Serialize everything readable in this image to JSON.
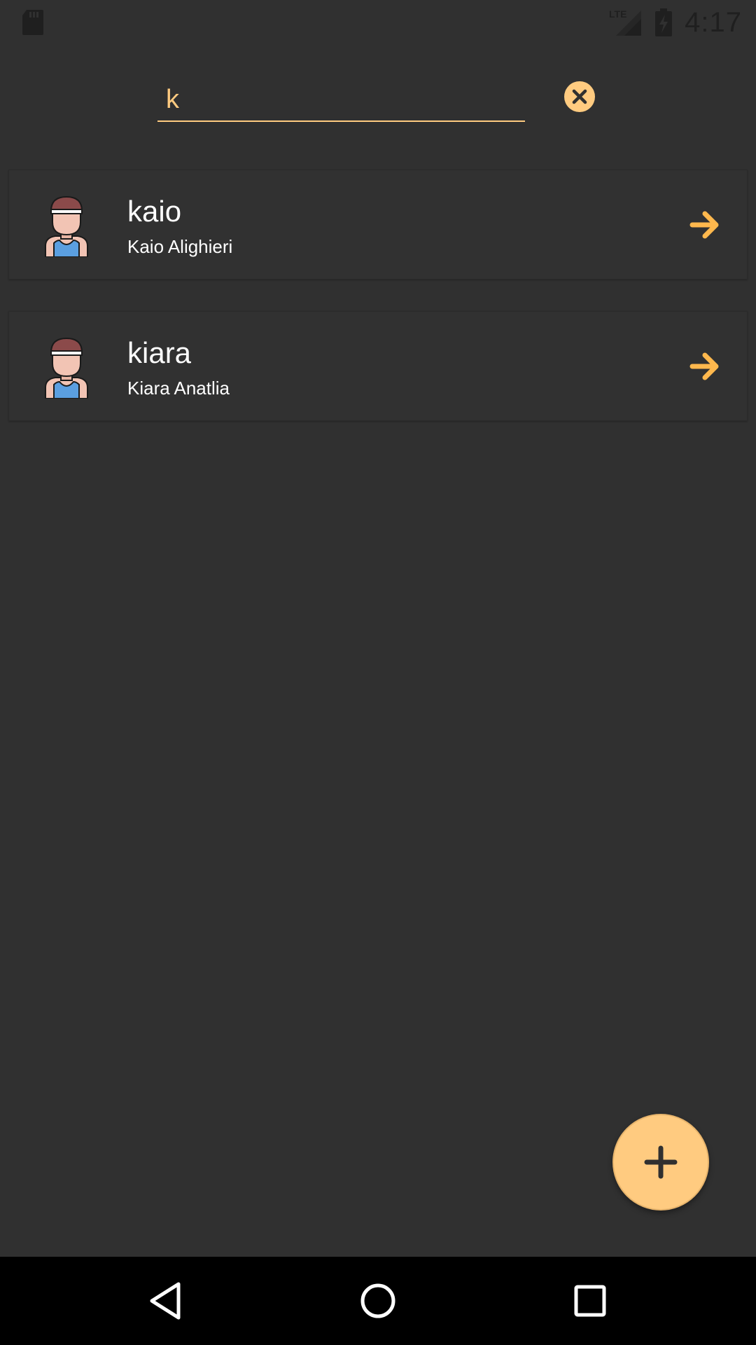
{
  "status_bar": {
    "time": "4:17",
    "network_label": "LTE"
  },
  "search": {
    "value": "k",
    "placeholder": ""
  },
  "users": [
    {
      "username": "kaio",
      "full_name": "Kaio Alighieri"
    },
    {
      "username": "kiara",
      "full_name": "Kiara Anatlia"
    }
  ],
  "icons": {
    "clear": "close-circle-icon",
    "row_action": "arrow-right-icon",
    "fab": "plus-icon",
    "avatar": "user-avatar-icon",
    "nav_back": "back-triangle-icon",
    "nav_home": "home-circle-icon",
    "nav_recents": "recents-square-icon"
  },
  "colors": {
    "background": "#303030",
    "accent": "#ffcb80",
    "text": "#ffffff",
    "nav_bar": "#000000"
  }
}
